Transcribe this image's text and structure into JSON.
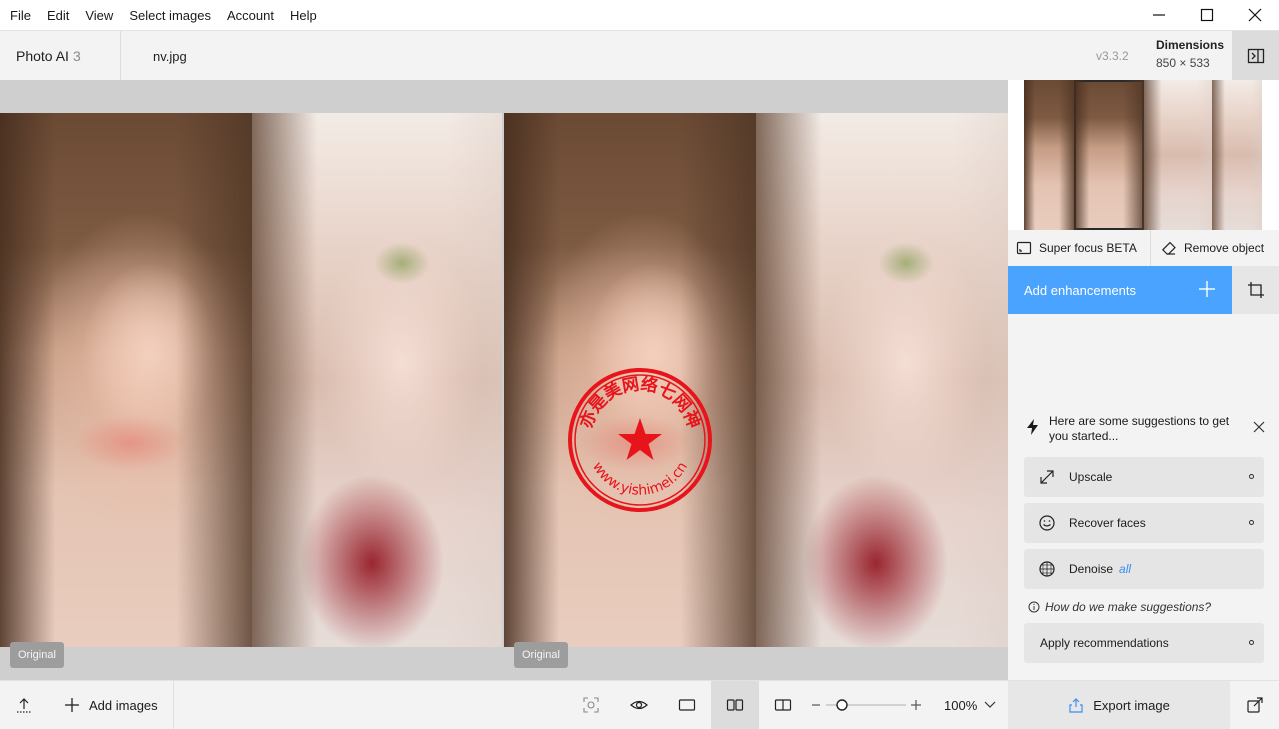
{
  "menu": {
    "items": [
      "File",
      "Edit",
      "View",
      "Select images",
      "Account",
      "Help"
    ]
  },
  "window_controls": {
    "minimize": "minimize-icon",
    "maximize": "maximize-icon",
    "close": "close-icon"
  },
  "header": {
    "app_name": "Photo AI",
    "image_count": "3",
    "file_name": "nv.jpg",
    "version": "v3.3.2",
    "dimensions_label": "Dimensions",
    "dimensions_value": "850 × 533"
  },
  "canvas": {
    "original_label_left": "Original",
    "original_label_right": "Original"
  },
  "stamp": {
    "text_top": "亦是美网络七网神",
    "text_bottom": "www.yishimei.cn",
    "color": "#e8141b"
  },
  "right_panel": {
    "super_focus": "Super focus BETA",
    "remove_object": "Remove object",
    "add_enhancements": "Add enhancements",
    "suggestions_header": "Here are some suggestions to get you started...",
    "suggestions": [
      {
        "label": "Upscale",
        "icon": "expand-arrows-icon",
        "extra": ""
      },
      {
        "label": "Recover faces",
        "icon": "smile-face-icon",
        "extra": ""
      },
      {
        "label": "Denoise",
        "icon": "denoise-grid-icon",
        "extra": "all"
      }
    ],
    "how_link": "How do we make suggestions?",
    "apply": "Apply recommendations"
  },
  "bottombar": {
    "add_images": "Add images",
    "zoom": "100%",
    "zoom_level": 0.2,
    "export": "Export image"
  },
  "colors": {
    "accent": "#4aa3ff"
  }
}
